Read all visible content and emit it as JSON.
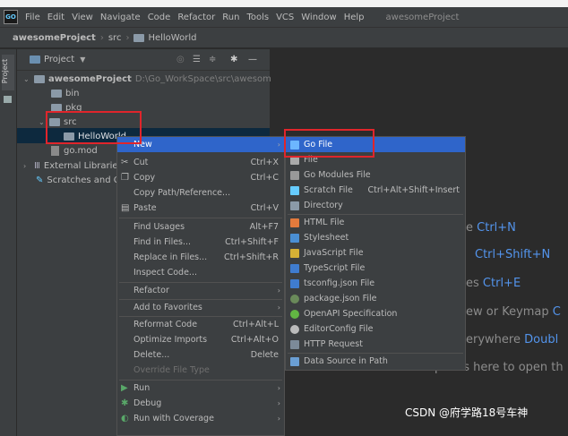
{
  "menubar": {
    "logo": "GO",
    "items": [
      "File",
      "Edit",
      "View",
      "Navigate",
      "Code",
      "Refactor",
      "Run",
      "Tools",
      "VCS",
      "Window",
      "Help"
    ],
    "project": "awesomeProject"
  },
  "breadcrumb": [
    "awesomeProject",
    "src",
    "HelloWorld"
  ],
  "toolstrip": {
    "label": "Project"
  },
  "project_panel": {
    "title": "Project",
    "tree": {
      "root_label": "awesomeProject",
      "root_path": "D:\\Go_WorkSpace\\src\\awesomeP",
      "bin": "bin",
      "pkg": "pkg",
      "src": "src",
      "helloworld": "HelloWorld",
      "gomod": "go.mod",
      "ext_libs": "External Librarie",
      "scratches": "Scratches and C"
    }
  },
  "editor_hints": {
    "h1_prefix": "e",
    "h1_key": "Ctrl+N",
    "h2_key": "Ctrl+Shift+N",
    "h3_prefix": "es",
    "h3_key": "Ctrl+E",
    "h4_prefix": "ew or Keymap",
    "h4_key": "C",
    "h5_prefix": "erywhere",
    "h5_key": "Doubl",
    "h6": "Drop files here to open th"
  },
  "context_menu": {
    "new": "New",
    "cut": "Cut",
    "cut_sc": "Ctrl+X",
    "copy": "Copy",
    "copy_sc": "Ctrl+C",
    "copy_path": "Copy Path/Reference...",
    "paste": "Paste",
    "paste_sc": "Ctrl+V",
    "find_usages": "Find Usages",
    "find_usages_sc": "Alt+F7",
    "find_in_files": "Find in Files...",
    "find_in_files_sc": "Ctrl+Shift+F",
    "replace_in_files": "Replace in Files...",
    "replace_in_files_sc": "Ctrl+Shift+R",
    "inspect_code": "Inspect Code...",
    "refactor": "Refactor",
    "add_favorites": "Add to Favorites",
    "reformat": "Reformat Code",
    "reformat_sc": "Ctrl+Alt+L",
    "optimize": "Optimize Imports",
    "optimize_sc": "Ctrl+Alt+O",
    "delete": "Delete...",
    "delete_sc": "Delete",
    "override_ft": "Override File Type",
    "run": "Run",
    "debug": "Debug",
    "run_coverage": "Run with Coverage"
  },
  "submenu": {
    "go_file": "Go File",
    "file": "File",
    "go_modules": "Go Modules File",
    "scratch": "Scratch File",
    "scratch_sc": "Ctrl+Alt+Shift+Insert",
    "directory": "Directory",
    "html": "HTML File",
    "stylesheet": "Stylesheet",
    "js": "JavaScript File",
    "ts": "TypeScript File",
    "tsconfig": "tsconfig.json File",
    "packagejson": "package.json File",
    "openapi": "OpenAPI Specification",
    "editorconfig": "EditorConfig File",
    "http": "HTTP Request",
    "datasource": "Data Source in Path"
  },
  "watermark": "CSDN @府学路18号车神",
  "colors": {
    "accent": "#2f65ca",
    "annotation": "#e0252b",
    "shortcut": "#5394ec"
  }
}
